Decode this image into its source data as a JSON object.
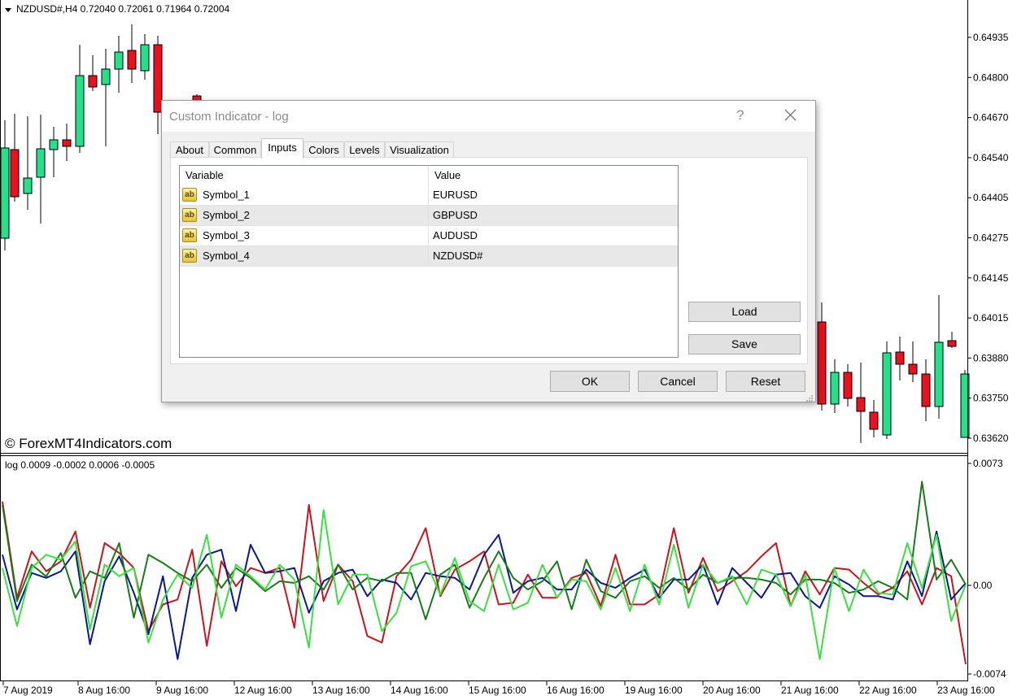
{
  "chart": {
    "title": "NZDUSD#,H4  0.72040 0.72061 0.71964 0.72004",
    "watermark": "© ForexMT4Indicators.com",
    "colors": {
      "bull": "#26e08a",
      "bear": "#e8111d",
      "wick": "#000000"
    },
    "price_axis": [
      "0.64935",
      "0.64800",
      "0.64670",
      "0.64540",
      "0.64405",
      "0.64275",
      "0.64145",
      "0.64015",
      "0.63880",
      "0.63750",
      "0.63620"
    ],
    "time_axis": [
      "7 Aug 2019",
      "8 Aug 16:00",
      "9 Aug 16:00",
      "12 Aug 16:00",
      "13 Aug 16:00",
      "14 Aug 16:00",
      "15 Aug 16:00",
      "16 Aug 16:00",
      "19 Aug 16:00",
      "20 Aug 16:00",
      "21 Aug 16:00",
      "22 Aug 16:00",
      "23 Aug 16:00"
    ]
  },
  "indicator": {
    "title": "log 0.0009 -0.0002 0.0006 -0.0005",
    "axis": [
      "0.0073",
      "0.00",
      "-0.0074"
    ],
    "series": [
      {
        "color": "#c8141e",
        "values": [
          0.005,
          -0.0008,
          0.002,
          0.0008,
          0.0014,
          0.0032,
          -0.0014,
          0.0025,
          0.0019,
          0.001,
          -0.0028,
          -0.0012,
          -0.0009,
          0.0021,
          -0.0037,
          0.0014,
          -0.0001,
          0.001,
          0.0007,
          0.001,
          -0.0026,
          0.0048,
          -0.001,
          0.0012,
          0.0002,
          -0.0031,
          -0.0035,
          0.0005,
          0.0015,
          0.0034,
          -0.0007,
          0.0009,
          0.0014,
          0.002,
          -0.0012,
          -0.0011,
          0.0006,
          -0.0008,
          -0.0008,
          0.0004,
          0.0007,
          -0.0013,
          0.0018,
          -0.0012,
          -0.0012,
          -0.0006,
          0.0034,
          -0.0005,
          0.0016,
          -0.0004,
          0.0002,
          0.0008,
          0.0017,
          0.0025,
          -0.0013,
          0.0008,
          -0.0006,
          0.001,
          0.0009,
          0.0001,
          -0.0006,
          -0.0002,
          0.0008,
          -0.0012,
          0.001,
          0.0005,
          -0.0048
        ]
      },
      {
        "color": "#0a1a8c",
        "values": [
          0.0018,
          -0.0015,
          0.0007,
          0.0004,
          0.0008,
          0.002,
          -0.0036,
          0.0002,
          0.0017,
          -0.0005,
          -0.003,
          0.0005,
          -0.0045,
          0.0004,
          0.0018,
          0.0021,
          -0.0016,
          0.0024,
          0.0007,
          0.0008,
          0.001,
          -0.0017,
          0.0002,
          0.0007,
          0.0009,
          -0.0007,
          0.0003,
          0.0001,
          -0.0009,
          0.0007,
          0.0005,
          0.0004,
          -0.0003,
          0.0018,
          0.003,
          -0.0005,
          0.0002,
          0.0004,
          -0.0003,
          -0.0003,
          0.0009,
          0.0001,
          -0.0002,
          0.0004,
          0.0009,
          -0.0008,
          0.0003,
          0.0003,
          0.0012,
          -0.0012,
          0.001,
          0.0001,
          -0.0008,
          0.0006,
          0.0007,
          -0.0007,
          -0.0014,
          0.0005,
          0.0,
          -0.0007,
          -0.0007,
          -0.0009,
          0.0014,
          -0.0007,
          0.0032,
          -0.0009,
          0.0001
        ]
      },
      {
        "color": "#197a1c",
        "values": [
          0.0048,
          -0.001,
          0.0012,
          0.0005,
          0.0019,
          -0.0008,
          0.0008,
          0.0004,
          0.0025,
          -0.002,
          0.0018,
          0.0013,
          0.0007,
          0.0002,
          0.0012,
          -0.0002,
          0.001,
          0.0004,
          -0.0004,
          0.0002,
          0.0001,
          0.0005,
          -0.0003,
          0.0012,
          -0.0003,
          0.0004,
          0.0002,
          0.0007,
          0.0007,
          -0.0021,
          0.0006,
          0.0012,
          -0.0014,
          0.0004,
          0.002,
          0.0004,
          -0.0003,
          0.0002,
          0.0014,
          -0.0015,
          0.0015,
          -0.0004,
          -0.0008,
          0.0002,
          0.0005,
          -0.0002,
          0.0004,
          -0.0003,
          0.0006,
          0.0001,
          0.0004,
          0.0004,
          0.0003,
          0.0001,
          -0.0006,
          0.0003,
          0.0003,
          0.0001,
          -0.0005,
          -0.0003,
          0.0002,
          -0.0002,
          -0.0009,
          0.0062,
          0.0003,
          0.0015,
          0.0
        ]
      },
      {
        "color": "#3ae040",
        "values": [
          0.001,
          -0.0025,
          0.001,
          0.0018,
          0.0015,
          0.0026,
          -0.0027,
          0.0012,
          0.0005,
          0.001,
          -0.0035,
          -0.0009,
          0.0006,
          -0.0002,
          0.003,
          -0.002,
          0.0012,
          0.0005,
          -0.0003,
          0.0012,
          0.0003,
          -0.0038,
          0.0045,
          -0.0012,
          0.0006,
          0.0006,
          -0.0028,
          -0.0017,
          0.0011,
          0.0014,
          -0.0006,
          0.0016,
          -0.001,
          -0.0016,
          0.0012,
          -0.0015,
          -0.0011,
          0.0012,
          -0.0008,
          0.0003,
          0.0002,
          -0.0015,
          0.001,
          -0.0016,
          0.0012,
          -0.0012,
          0.0024,
          -0.0014,
          0.0012,
          0.0001,
          0.0005,
          -0.0012,
          0.0009,
          0.0006,
          -0.0013,
          0.0006,
          -0.0045,
          0.001,
          -0.0016,
          0.0009,
          -0.0005,
          -0.0006,
          0.0025,
          -0.0002,
          0.003,
          -0.0022,
          0.0
        ]
      }
    ]
  },
  "dialog": {
    "title": "Custom Indicator - log",
    "help": "?",
    "tabs": [
      "About",
      "Common",
      "Inputs",
      "Colors",
      "Levels",
      "Visualization"
    ],
    "columns": {
      "variable": "Variable",
      "value": "Value"
    },
    "icon_text": "ab",
    "rows": [
      {
        "variable": "Symbol_1",
        "value": "EURUSD"
      },
      {
        "variable": "Symbol_2",
        "value": "GBPUSD"
      },
      {
        "variable": "Symbol_3",
        "value": "AUDUSD"
      },
      {
        "variable": "Symbol_4",
        "value": "NZDUSD#"
      }
    ],
    "buttons": {
      "load": "Load",
      "save": "Save",
      "ok": "OK",
      "cancel": "Cancel",
      "reset": "Reset"
    }
  }
}
